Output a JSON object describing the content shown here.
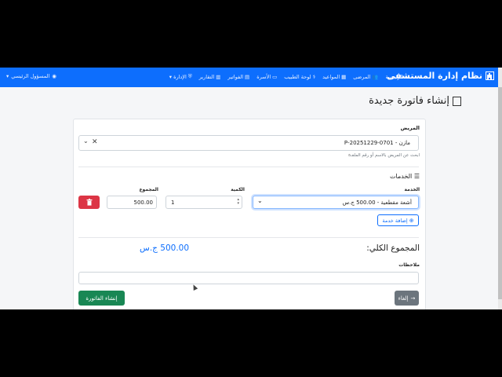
{
  "navbar": {
    "brand": "نظام إدارة المستشفى",
    "items": [
      {
        "label": "الرئيسية",
        "icon": "home-icon",
        "glyph": "⌂"
      },
      {
        "label": "المرضى",
        "icon": "people-icon",
        "glyph": "👥"
      },
      {
        "label": "المواعيد",
        "icon": "calendar-icon",
        "glyph": "▦"
      },
      {
        "label": "لوحة الطبيب",
        "icon": "doctor-icon",
        "glyph": "⚕"
      },
      {
        "label": "الأسرة",
        "icon": "bed-icon",
        "glyph": "▭"
      },
      {
        "label": "الفواتير",
        "icon": "invoice-icon",
        "glyph": "▤"
      },
      {
        "label": "التقارير",
        "icon": "chart-icon",
        "glyph": "▥"
      },
      {
        "label": "الإدارة",
        "icon": "shield-icon",
        "glyph": "⛨"
      }
    ],
    "dropdown_glyph": "▾",
    "user_label": "المسؤول الرئيسي",
    "user_icon_glyph": "◉"
  },
  "page": {
    "title": "إنشاء فاتورة جديدة"
  },
  "form": {
    "patient_label": "المريض",
    "patient_value": "مازن - 0701-20251229-P",
    "patient_help": "ابحث عن المريض بالاسم أو رقم الملف",
    "services_header": "الخدمات",
    "service_col_label": "الخدمة",
    "quantity_col_label": "الكمية",
    "total_col_label": "المجموع",
    "service_value": "أشعة مقطعية - 500.00 ج.س",
    "quantity_value": "1",
    "row_total_value": "500.00",
    "add_service_label": "إضافة خدمة",
    "grand_total_label": "المجموع الكلي:",
    "grand_total_value": "500.00 ج.س",
    "notes_label": "ملاحظات",
    "notes_value": "",
    "submit_label": "إنشاء الفاتورة",
    "cancel_label": "إلغاء",
    "clear_glyph": "✕",
    "caret_glyph": "⌄"
  },
  "colors": {
    "primary": "#0d6efd",
    "danger": "#dc3545",
    "success": "#198754",
    "secondary": "#6c757d"
  }
}
